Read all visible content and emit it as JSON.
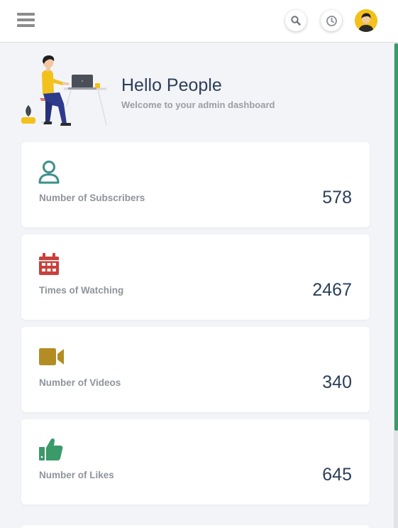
{
  "topbar": {
    "menu_icon": "hamburger-icon",
    "search_icon": "search-icon",
    "history_icon": "clock-icon",
    "avatar_icon": "user-avatar"
  },
  "hero": {
    "title": "Hello People",
    "subtitle": "Welcome to your admin dashboard"
  },
  "stats": [
    {
      "icon": "user-icon",
      "label": "Number of Subscribers",
      "value": "578",
      "color": "#3d8f8c"
    },
    {
      "icon": "calendar-icon",
      "label": "Times of Watching",
      "value": "2467",
      "color": "#c9403b"
    },
    {
      "icon": "video-camera-icon",
      "label": "Number of Videos",
      "value": "340",
      "color": "#b38d23"
    },
    {
      "icon": "thumbs-up-icon",
      "label": "Number of Likes",
      "value": "645",
      "color": "#3a9a6a"
    }
  ],
  "colors": {
    "heading": "#2b3f5a",
    "muted": "#8f949b",
    "accent": "#3a9a6a",
    "background": "#f3f4f7"
  }
}
